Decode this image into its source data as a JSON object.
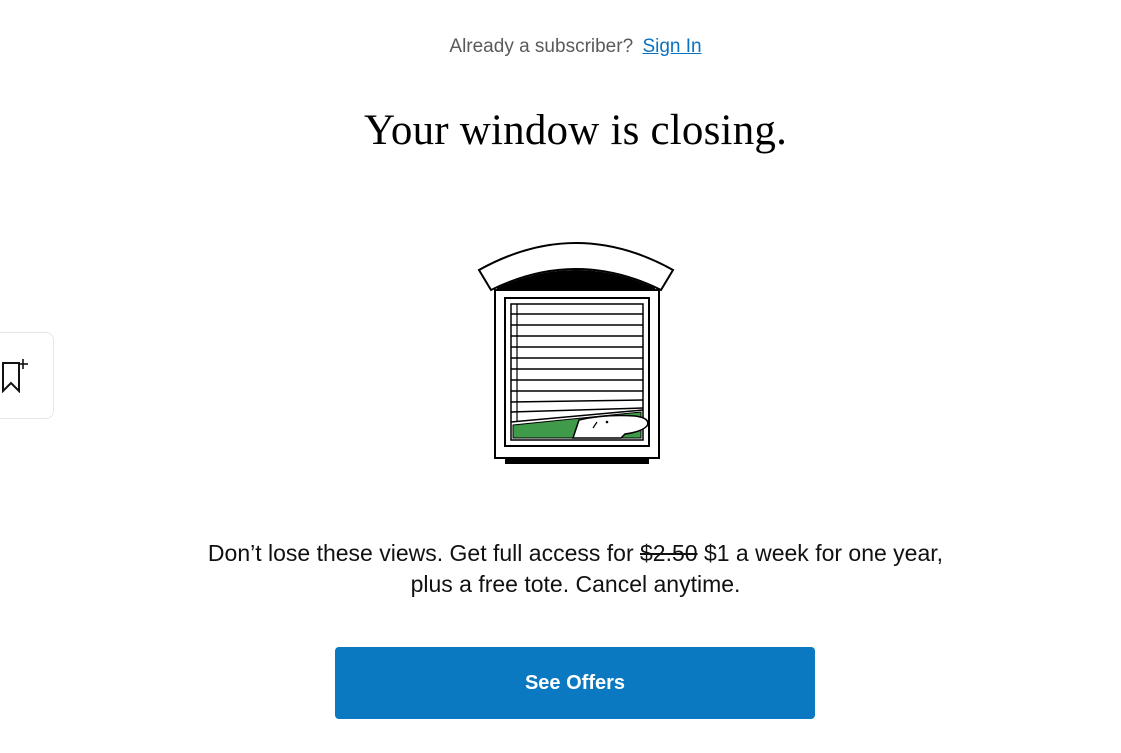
{
  "signin": {
    "prompt": "Already a subscriber?",
    "link_label": "Sign In"
  },
  "headline": "Your window is closing.",
  "offer": {
    "line1_prefix": "Don’t lose these views. Get full access for",
    "old_price": "$2.50",
    "line1_suffix": "$1 a week for one year,",
    "line2": "plus a free tote. Cancel anytime."
  },
  "cta": {
    "label": "See Offers"
  },
  "icons": {
    "illustration": "window-blinds-dog-illustration",
    "bookmark": "bookmark-add-icon"
  },
  "colors": {
    "link": "#0a72c2",
    "button": "#0a79c2",
    "grass": "#3f9a4a"
  }
}
